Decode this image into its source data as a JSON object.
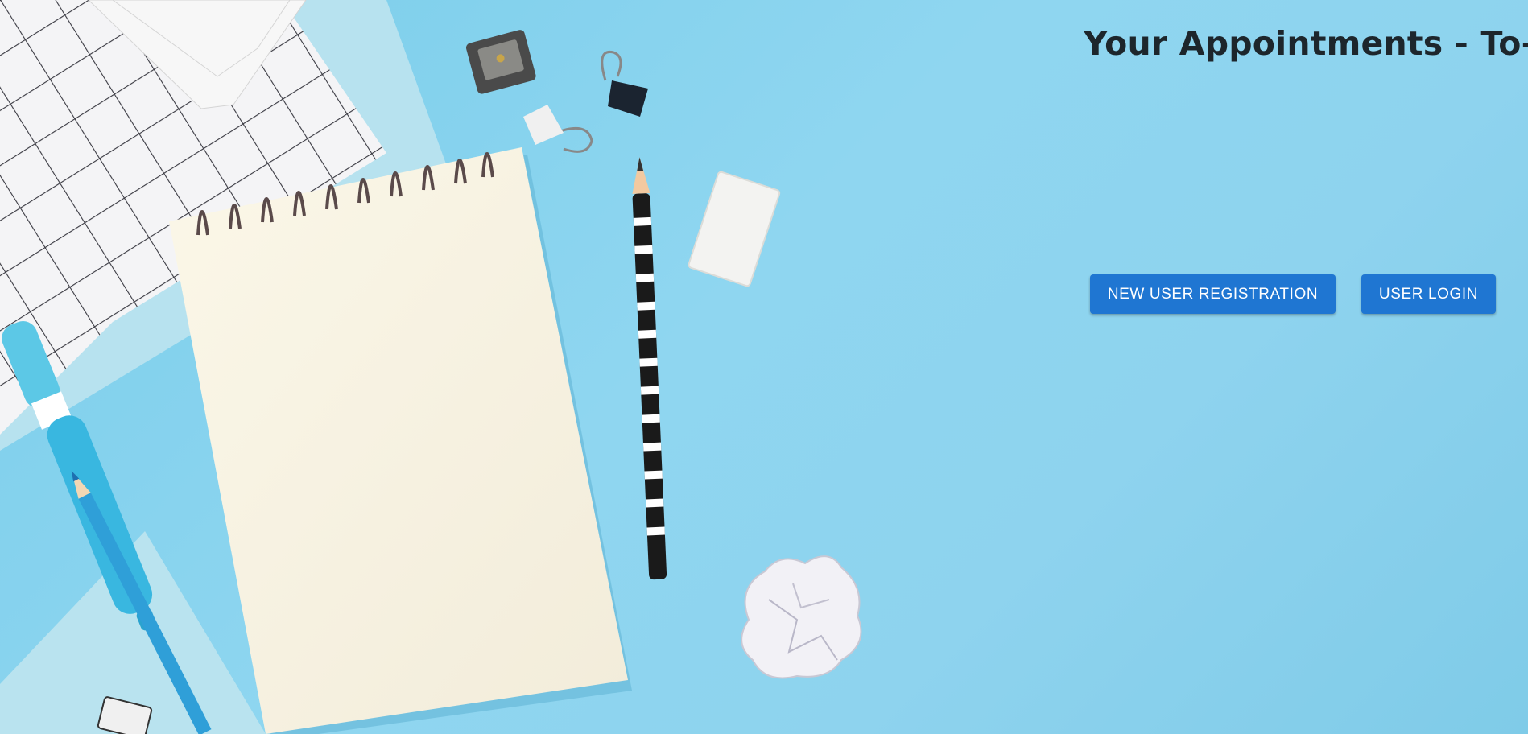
{
  "header": {
    "title": "Your Appointments - To-Do"
  },
  "actions": {
    "register_label": "NEW USER REGISTRATION",
    "login_label": "USER LOGIN"
  },
  "colors": {
    "background": "#8fd6f0",
    "button": "#1f76d2",
    "button_text": "#ffffff",
    "title_text": "#1d262c"
  },
  "decor": [
    "grid-paper",
    "spiral-notepad",
    "striped-pencil",
    "eraser",
    "sharpener",
    "binder-clip",
    "highlighter",
    "colored-pencil",
    "crumpled-paper"
  ]
}
